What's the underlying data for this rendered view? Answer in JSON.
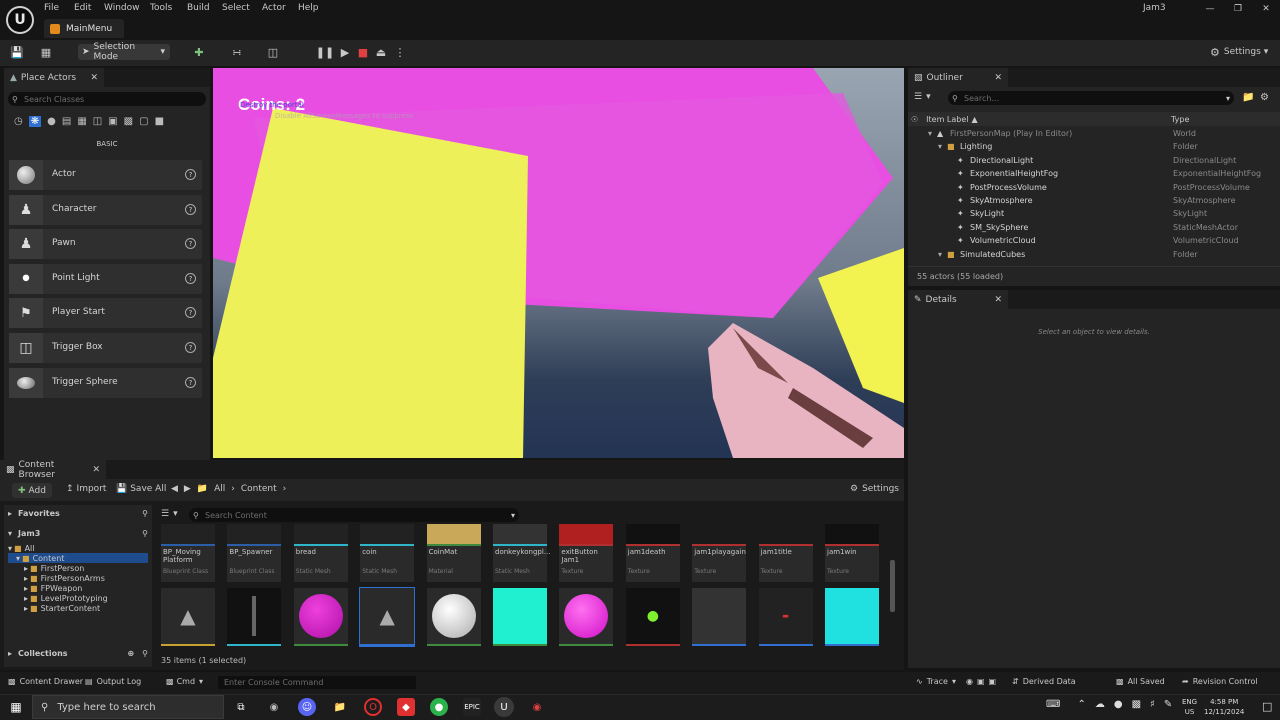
{
  "titlebar": {
    "logo": "U",
    "menu": [
      "File",
      "Edit",
      "Window",
      "Tools",
      "Build",
      "Select",
      "Actor",
      "Help"
    ],
    "project": "Jam3",
    "level_tab": "MainMenu"
  },
  "toolbar": {
    "selection_mode": "Selection Mode",
    "settings": "Settings"
  },
  "place_actors": {
    "title": "Place Actors",
    "search_placeholder": "Search Classes",
    "category": "BASIC",
    "items": [
      "Actor",
      "Character",
      "Pawn",
      "Point Light",
      "Player Start",
      "Trigger Box",
      "Trigger Sphere"
    ]
  },
  "viewport": {
    "hud_coins": "Coins: 2",
    "debug_msg": "Destroy the portal",
    "debug_sub": "Disable AllScreenMessages to suppress"
  },
  "outliner": {
    "title": "Outliner",
    "search_placeholder": "Search...",
    "col_label": "Item Label",
    "col_type": "Type",
    "rows": [
      {
        "label": "FirstPersonMap (Play In Editor)",
        "type": "World",
        "indent": 0
      },
      {
        "label": "Lighting",
        "type": "Folder",
        "indent": 1
      },
      {
        "label": "DirectionalLight",
        "type": "DirectionalLight",
        "indent": 2
      },
      {
        "label": "ExponentialHeightFog",
        "type": "ExponentialHeightFog",
        "indent": 2
      },
      {
        "label": "PostProcessVolume",
        "type": "PostProcessVolume",
        "indent": 2
      },
      {
        "label": "SkyAtmosphere",
        "type": "SkyAtmosphere",
        "indent": 2
      },
      {
        "label": "SkyLight",
        "type": "SkyLight",
        "indent": 2
      },
      {
        "label": "SM_SkySphere",
        "type": "StaticMeshActor",
        "indent": 2
      },
      {
        "label": "VolumetricCloud",
        "type": "VolumetricCloud",
        "indent": 2
      },
      {
        "label": "SimulatedCubes",
        "type": "Folder",
        "indent": 1
      }
    ],
    "footer": "55 actors (55 loaded)"
  },
  "details": {
    "title": "Details",
    "empty_msg": "Select an object to view details."
  },
  "content_browser": {
    "title": "Content Browser",
    "add": "Add",
    "import": "Import",
    "save_all": "Save All",
    "path": [
      "All",
      "Content"
    ],
    "settings": "Settings",
    "favorites": "Favorites",
    "project": "Jam3",
    "search_placeholder": "Search Content",
    "tree": [
      "All",
      "Content",
      "FirstPerson",
      "FirstPersonArms",
      "FPWeapon",
      "LevelPrototyping",
      "StarterContent"
    ],
    "collections": "Collections",
    "count": "35 items (1 selected)",
    "row1": [
      {
        "name": "BP_Moving Platform",
        "type": "Blueprint Class",
        "color": "#2a5fa8"
      },
      {
        "name": "BP_Spawner",
        "type": "Blueprint Class",
        "color": "#2a5fa8"
      },
      {
        "name": "bread",
        "type": "Static Mesh",
        "color": "#2fb5c9"
      },
      {
        "name": "coin",
        "type": "Static Mesh",
        "color": "#2fb5c9"
      },
      {
        "name": "CoinMat",
        "type": "Material",
        "color": "#3e8b3e"
      },
      {
        "name": "donkeykongpl...",
        "type": "Static Mesh",
        "color": "#2fb5c9"
      },
      {
        "name": "exitButton Jam1",
        "type": "Texture",
        "color": "#b03030"
      },
      {
        "name": "jam1death",
        "type": "Texture",
        "color": "#b03030"
      },
      {
        "name": "jam1playagain",
        "type": "Texture",
        "color": "#b03030"
      },
      {
        "name": "jam1title",
        "type": "Texture",
        "color": "#b03030"
      },
      {
        "name": "jam1win",
        "type": "Texture",
        "color": "#b03030"
      }
    ]
  },
  "statusbar": {
    "content_drawer": "Content Drawer",
    "output_log": "Output Log",
    "cmd": "Cmd",
    "console_placeholder": "Enter Console Command",
    "trace": "Trace",
    "derived_data": "Derived Data",
    "all_saved": "All Saved",
    "revision_control": "Revision Control"
  },
  "taskbar": {
    "search_placeholder": "Type here to search",
    "lang1": "ENG",
    "lang2": "US",
    "time": "4:58 PM",
    "date": "12/11/2024"
  }
}
